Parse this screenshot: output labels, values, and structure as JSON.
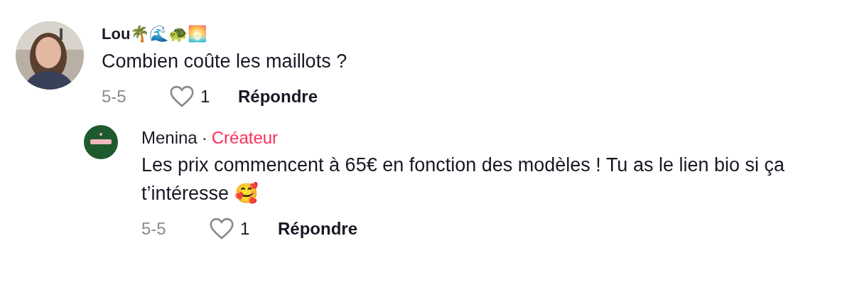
{
  "comments": [
    {
      "author": "Lou🌴🌊🐢🌅",
      "text": "Combien coûte les maillots ?",
      "date": "5-5",
      "likes": "1",
      "reply_label": "Répondre",
      "replies": [
        {
          "author": "Menina",
          "separator": "·",
          "badge": "Créateur",
          "avatar": {
            "kind": "logo"
          },
          "text": "Les prix commencent à 65€ en fonction des modèles ! Tu as le lien bio si ça t’intéresse 🥰",
          "date": "5-5",
          "likes": "1",
          "reply_label": "Répondre"
        }
      ]
    }
  ]
}
